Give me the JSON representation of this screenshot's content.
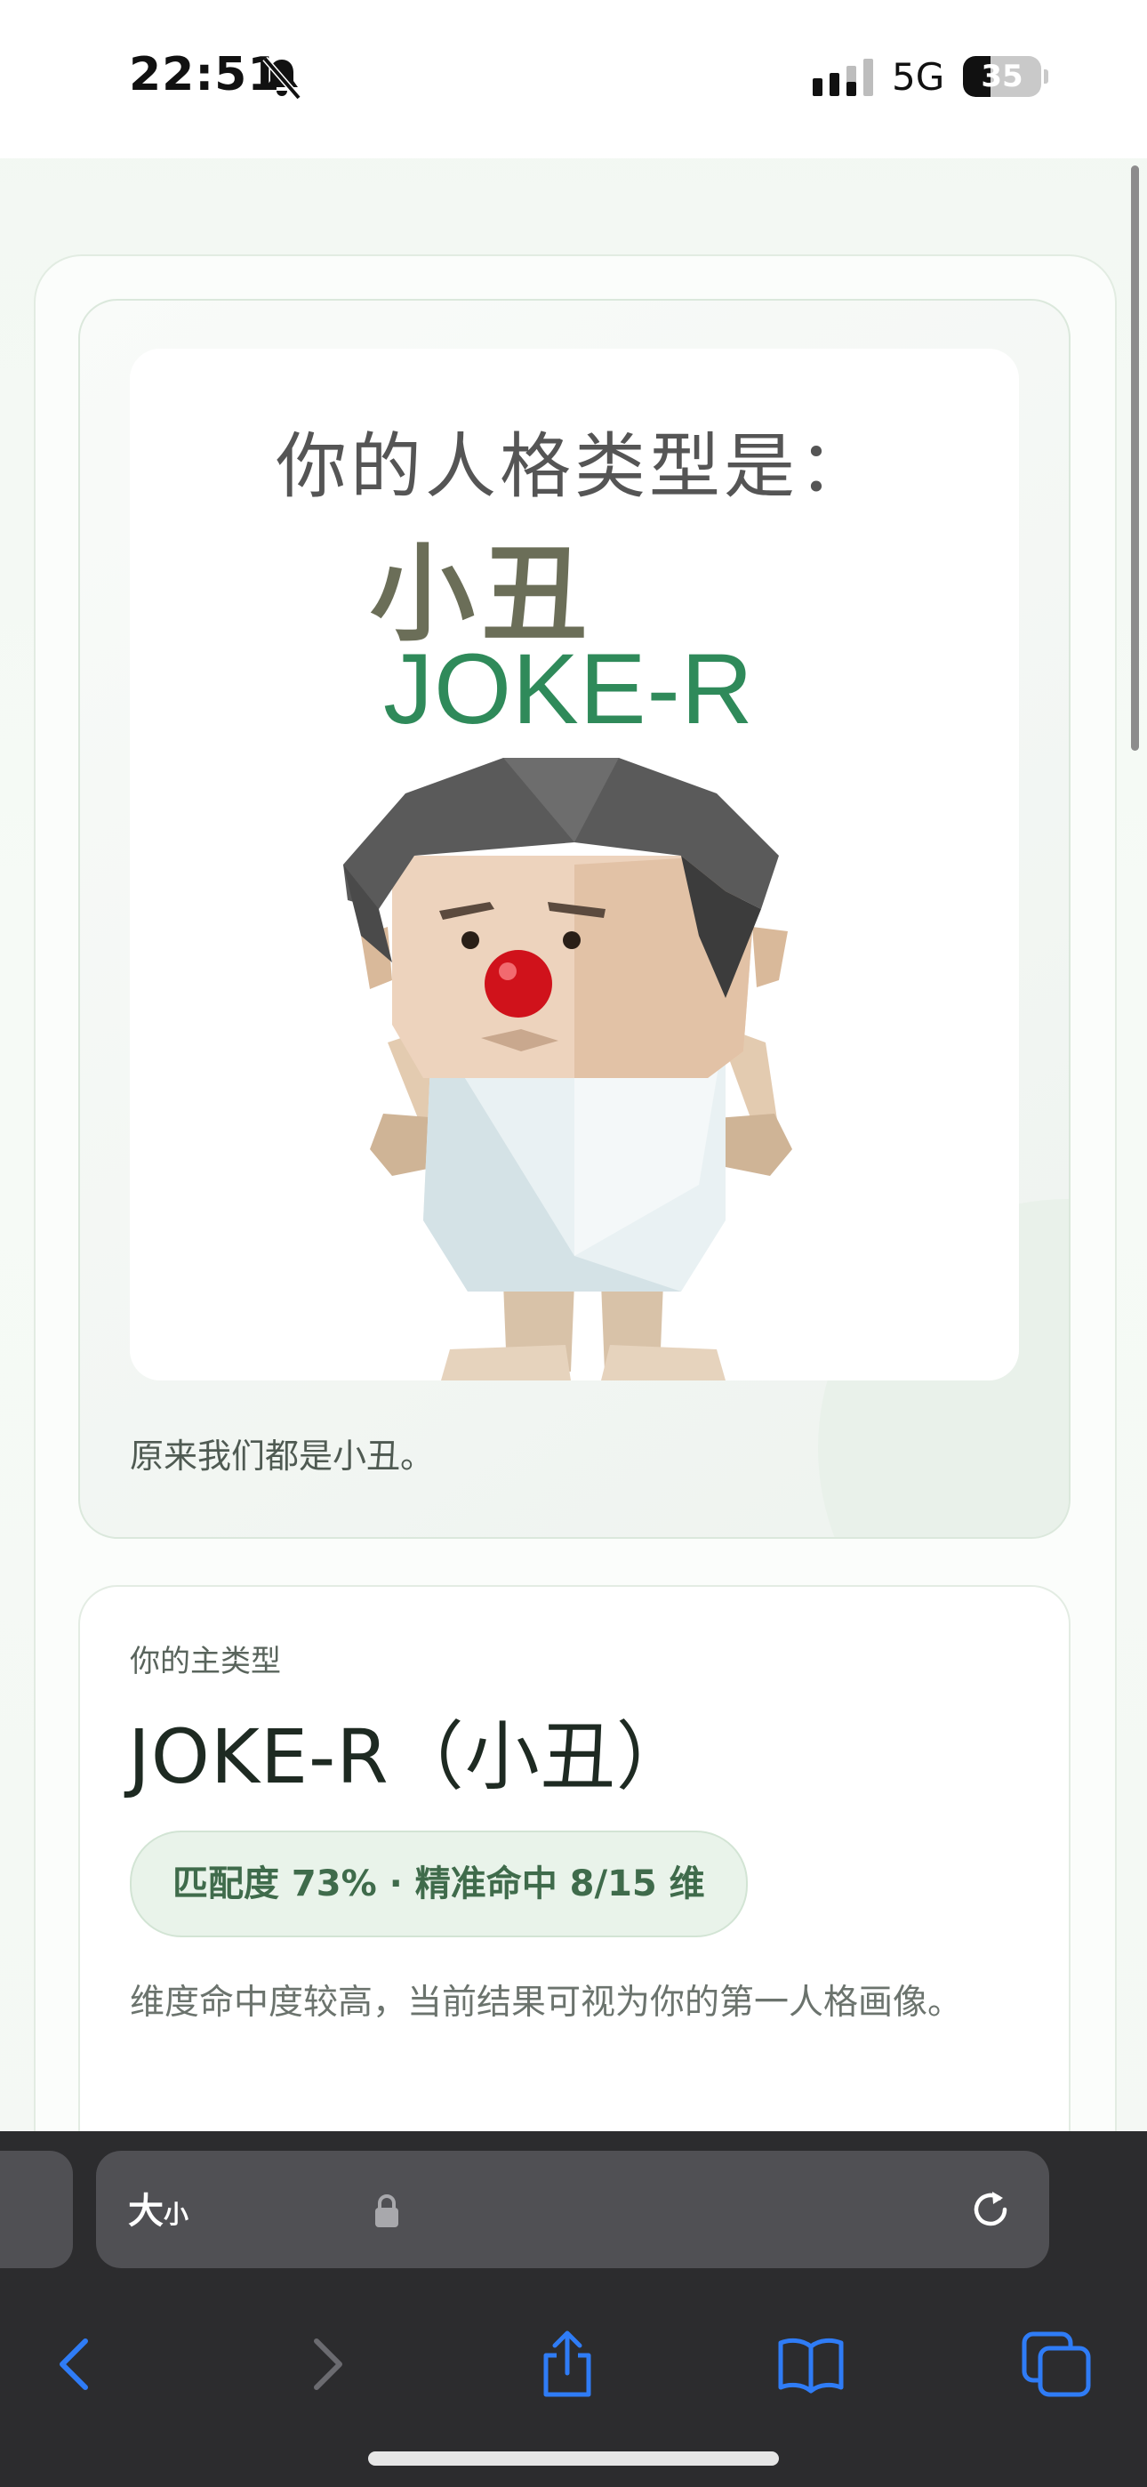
{
  "status_bar": {
    "time": "22:51",
    "network": "5G",
    "battery_level": 35,
    "battery_text": "35",
    "icons": [
      "bell-slash-icon",
      "cellular-signal-icon",
      "battery-icon"
    ]
  },
  "result_card": {
    "image": {
      "heading": "你的人格类型是：",
      "type_cn": "小丑",
      "type_code": "JOKE-R",
      "figure": "clown-figure"
    },
    "caption": "原来我们都是小丑。"
  },
  "type_card": {
    "kicker": "你的主类型",
    "title": "JOKE-R（小丑）",
    "match": "匹配度 73% · 精准命中 8/15 维",
    "description": "维度命中度较高，当前结果可视为你的第一人格画像。"
  },
  "browser": {
    "text_size_big": "大",
    "text_size_small": "小",
    "toolbar": [
      "back-icon",
      "forward-icon",
      "share-icon",
      "bookmarks-icon",
      "tabs-icon"
    ]
  },
  "colors": {
    "accent_green": "#2f8a5a",
    "pill_bg": "#e9f3ea",
    "toolbar_blue": "#2f7cf6"
  }
}
